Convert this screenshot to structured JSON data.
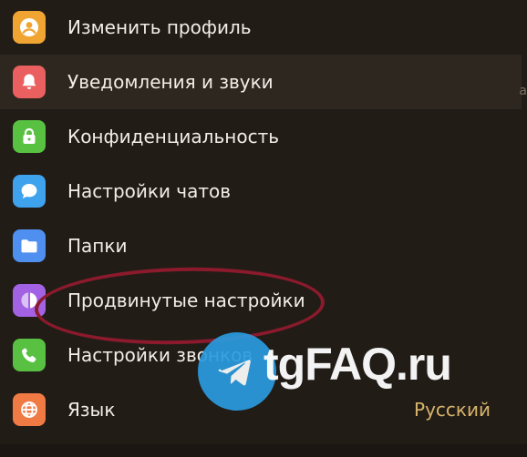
{
  "menu": {
    "items": [
      {
        "label": "Изменить профиль",
        "icon": "profile-icon",
        "color": "#f0a533"
      },
      {
        "label": "Уведомления и звуки",
        "icon": "bell-icon",
        "color": "#ea5f5f"
      },
      {
        "label": "Конфиденциальность",
        "icon": "lock-icon",
        "color": "#58c142"
      },
      {
        "label": "Настройки чатов",
        "icon": "chat-bubble-icon",
        "color": "#3fa2ed"
      },
      {
        "label": "Папки",
        "icon": "folder-icon",
        "color": "#4f8ff0"
      },
      {
        "label": "Продвинутые настройки",
        "icon": "advanced-settings-icon",
        "color": "#a362e3"
      },
      {
        "label": "Настройки звонков",
        "icon": "phone-icon",
        "color": "#58c142"
      },
      {
        "label": "Язык",
        "icon": "globe-icon",
        "color": "#f07a44",
        "value": "Русский"
      }
    ]
  },
  "edge_char": "a",
  "watermark": {
    "text": "tgFAQ.ru"
  },
  "annotation_color": "#8a1a2c"
}
